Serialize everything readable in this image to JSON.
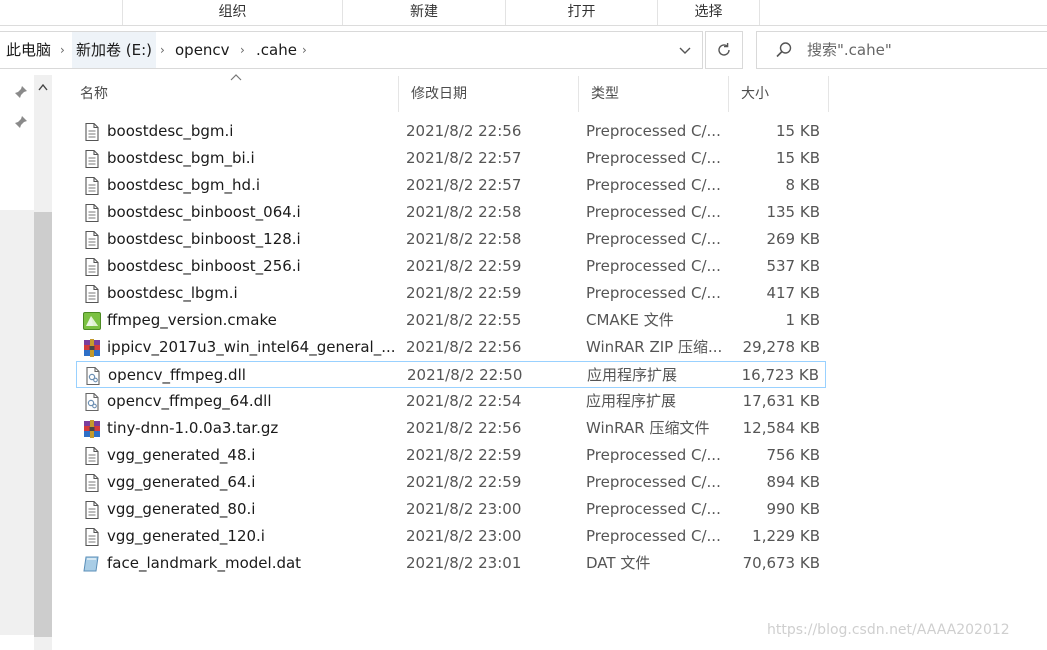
{
  "ribbon": {
    "groups": [
      "组织",
      "新建",
      "打开",
      "选择"
    ]
  },
  "address": {
    "crumbs": [
      "此电脑",
      "新加卷 (E:)",
      "opencv",
      ".cahe"
    ],
    "dropdown_icon": "chevron-down-icon",
    "refresh_icon": "refresh-icon"
  },
  "search": {
    "placeholder": "搜索\".cahe\""
  },
  "columns": {
    "name": "名称",
    "date": "修改日期",
    "type": "类型",
    "size": "大小"
  },
  "files": [
    {
      "name": "boostdesc_bgm.i",
      "date": "2021/8/2 22:56",
      "type": "Preprocessed C/...",
      "size": "15 KB",
      "icon": "document-icon"
    },
    {
      "name": "boostdesc_bgm_bi.i",
      "date": "2021/8/2 22:57",
      "type": "Preprocessed C/...",
      "size": "15 KB",
      "icon": "document-icon"
    },
    {
      "name": "boostdesc_bgm_hd.i",
      "date": "2021/8/2 22:57",
      "type": "Preprocessed C/...",
      "size": "8 KB",
      "icon": "document-icon"
    },
    {
      "name": "boostdesc_binboost_064.i",
      "date": "2021/8/2 22:58",
      "type": "Preprocessed C/...",
      "size": "135 KB",
      "icon": "document-icon"
    },
    {
      "name": "boostdesc_binboost_128.i",
      "date": "2021/8/2 22:58",
      "type": "Preprocessed C/...",
      "size": "269 KB",
      "icon": "document-icon"
    },
    {
      "name": "boostdesc_binboost_256.i",
      "date": "2021/8/2 22:59",
      "type": "Preprocessed C/...",
      "size": "537 KB",
      "icon": "document-icon"
    },
    {
      "name": "boostdesc_lbgm.i",
      "date": "2021/8/2 22:59",
      "type": "Preprocessed C/...",
      "size": "417 KB",
      "icon": "document-icon"
    },
    {
      "name": "ffmpeg_version.cmake",
      "date": "2021/8/2 22:55",
      "type": "CMAKE 文件",
      "size": "1 KB",
      "icon": "cmake-icon"
    },
    {
      "name": "ippicv_2017u3_win_intel64_general_...",
      "date": "2021/8/2 22:56",
      "type": "WinRAR ZIP 压缩...",
      "size": "29,278 KB",
      "icon": "winrar-icon"
    },
    {
      "name": "opencv_ffmpeg.dll",
      "date": "2021/8/2 22:50",
      "type": "应用程序扩展",
      "size": "16,723 KB",
      "icon": "dll-icon"
    },
    {
      "name": "opencv_ffmpeg_64.dll",
      "date": "2021/8/2 22:54",
      "type": "应用程序扩展",
      "size": "17,631 KB",
      "icon": "dll-icon"
    },
    {
      "name": "tiny-dnn-1.0.0a3.tar.gz",
      "date": "2021/8/2 22:56",
      "type": "WinRAR 压缩文件",
      "size": "12,584 KB",
      "icon": "winrar-icon"
    },
    {
      "name": "vgg_generated_48.i",
      "date": "2021/8/2 22:59",
      "type": "Preprocessed C/...",
      "size": "756 KB",
      "icon": "document-icon"
    },
    {
      "name": "vgg_generated_64.i",
      "date": "2021/8/2 22:59",
      "type": "Preprocessed C/...",
      "size": "894 KB",
      "icon": "document-icon"
    },
    {
      "name": "vgg_generated_80.i",
      "date": "2021/8/2 23:00",
      "type": "Preprocessed C/...",
      "size": "990 KB",
      "icon": "document-icon"
    },
    {
      "name": "vgg_generated_120.i",
      "date": "2021/8/2 23:00",
      "type": "Preprocessed C/...",
      "size": "1,229 KB",
      "icon": "document-icon"
    },
    {
      "name": "face_landmark_model.dat",
      "date": "2021/8/2 23:01",
      "type": "DAT 文件",
      "size": "70,673 KB",
      "icon": "dat-icon"
    }
  ],
  "selected_index": 9,
  "watermark": "https://blog.csdn.net/AAAA202012",
  "colors": {
    "selection_border": "#99d1ff",
    "scroll_thumb": "#cdcdcd"
  }
}
